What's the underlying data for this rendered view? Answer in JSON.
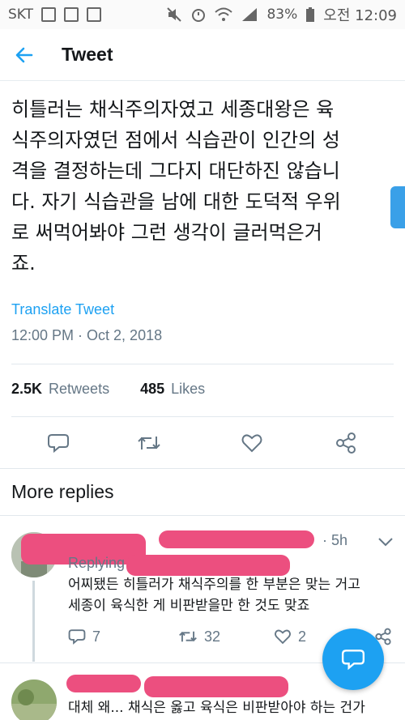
{
  "status_bar": {
    "carrier": "SKT",
    "battery": "83%",
    "time": "오전 12:09"
  },
  "header": {
    "back_icon": "arrow-left-icon",
    "title": "Tweet"
  },
  "tweet": {
    "text": "히틀러는 채식주의자였고 세종대왕은 육\n식주의자였던 점에서 식습관이 인간의 성\n격을 결정하는데 그다지 대단하진 않습니\n다. 자기 식습관을 남에 대한 도덕적 우위\n로 써먹어봐야 그런 생각이 글러먹은거\n죠.",
    "translate_label": "Translate Tweet",
    "timestamp": "12:00 PM · Oct 2, 2018",
    "retweets_count": "2.5K",
    "retweets_label": "Retweets",
    "likes_count": "485",
    "likes_label": "Likes"
  },
  "colors": {
    "accent": "#1da1f2",
    "secondary_text": "#657786",
    "redaction": "#ec4f7f"
  },
  "section_title": "More replies",
  "replies": [
    {
      "time": "· 5h",
      "replying_prefix": "Replying to",
      "text": "어찌됐든 히틀러가 채식주의를 한 부분은 맞는 거고\n세종이 육식한 게 비판받을만 한 것도 맞죠",
      "reply_count": "7",
      "retweet_count": "32",
      "like_count": "2"
    },
    {
      "text": "대체 왜... 채식은 옳고 육식은 비판받아야 하는 건가"
    }
  ],
  "fab_icon": "compose-reply-icon"
}
